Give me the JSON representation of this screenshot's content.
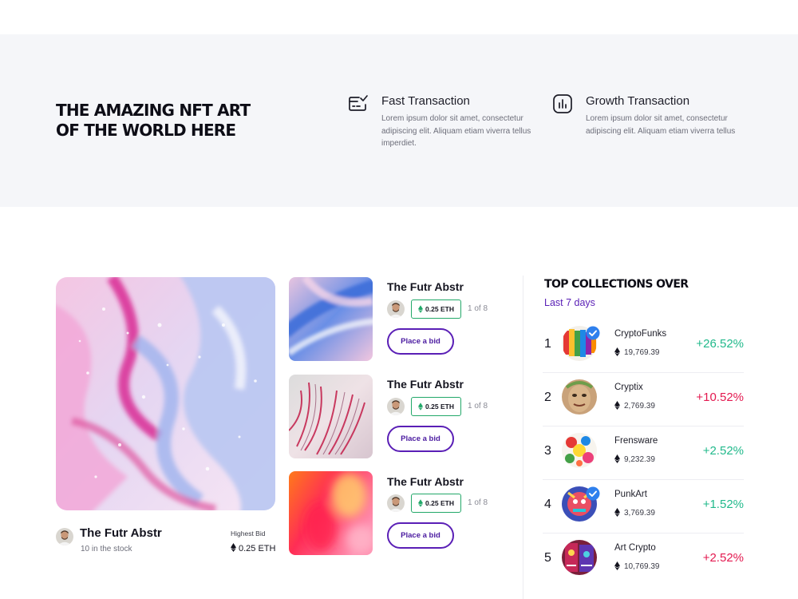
{
  "hero": {
    "title_line1": "THE AMAZING NFT ART",
    "title_line2": "OF THE WORLD HERE"
  },
  "features": [
    {
      "icon": "card-check-icon",
      "title": "Fast Transaction",
      "description": "Lorem ipsum dolor sit amet, consectetur adipiscing elit. Aliquam etiam viverra tellus imperdiet."
    },
    {
      "icon": "bar-chart-icon",
      "title": "Growth Transaction",
      "description": "Lorem ipsum dolor sit amet, consectetur adipiscing elit. Aliquam etiam viverra tellus"
    }
  ],
  "featured": {
    "name": "The Futr Abstr",
    "stock": "10 in the stock",
    "highest_bid_label": "Highest Bid",
    "highest_bid_value": "0.25 ETH"
  },
  "cards": [
    {
      "title": "The Futr Abstr",
      "price": "0.25 ETH",
      "count": "1 of 8",
      "button": "Place a bid"
    },
    {
      "title": "The Futr Abstr",
      "price": "0.25 ETH",
      "count": "1 of 8",
      "button": "Place a bid"
    },
    {
      "title": "The Futr Abstr",
      "price": "0.25 ETH",
      "count": "1 of 8",
      "button": "Place a bid"
    }
  ],
  "top_collections": {
    "title": "TOP COLLECTIONS OVER",
    "subtitle": "Last 7 days",
    "items": [
      {
        "rank": "1",
        "name": "CryptoFunks",
        "value": "19,769.39",
        "change": "+26.52%",
        "trend": "up",
        "verified": true
      },
      {
        "rank": "2",
        "name": "Cryptix",
        "value": "2,769.39",
        "change": "+10.52%",
        "trend": "down",
        "verified": false
      },
      {
        "rank": "3",
        "name": "Frensware",
        "value": "9,232.39",
        "change": "+2.52%",
        "trend": "up",
        "verified": false
      },
      {
        "rank": "4",
        "name": "PunkArt",
        "value": "3,769.39",
        "change": "+1.52%",
        "trend": "up",
        "verified": true
      },
      {
        "rank": "5",
        "name": "Art Crypto",
        "value": "10,769.39",
        "change": "+2.52%",
        "trend": "down",
        "verified": false
      }
    ]
  },
  "colors": {
    "accent": "#5a1fb6",
    "positive": "#21b98b",
    "negative": "#e3184f",
    "eth_badge_border": "#22a869",
    "band_background": "#f5f6f9"
  }
}
